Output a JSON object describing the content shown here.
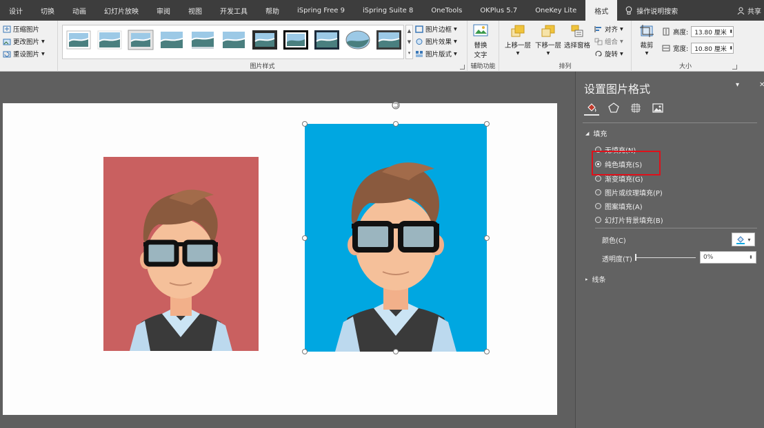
{
  "tabs": [
    "设计",
    "切换",
    "动画",
    "幻灯片放映",
    "审阅",
    "视图",
    "开发工具",
    "帮助",
    "iSpring Free 9",
    "iSpring Suite 8",
    "OneTools",
    "OKPlus 5.7",
    "OneKey Lite",
    "格式"
  ],
  "tell_me": "操作说明搜索",
  "share": "共享",
  "adjust": {
    "compress": "压缩图片",
    "change": "更改图片",
    "reset": "重设图片"
  },
  "picture_styles": {
    "group_label": "图片样式",
    "border": "图片边框",
    "effects": "图片效果",
    "layout": "图片版式"
  },
  "accessibility": {
    "alt_text": "替换文字",
    "group_label": "辅助功能"
  },
  "arrange": {
    "group_label": "排列",
    "forward": "上移一层",
    "backward": "下移一层",
    "selection_pane": "选择窗格",
    "align": "对齐",
    "group": "组合",
    "rotate": "旋转"
  },
  "size": {
    "group_label": "大小",
    "crop": "裁剪",
    "height_label": "高度:",
    "height_value": "13.80 厘米",
    "width_label": "宽度:",
    "width_value": "10.80 厘米"
  },
  "pane": {
    "title": "设置图片格式",
    "fill_section": "填充",
    "options": [
      "无填充(N)",
      "纯色填充(S)",
      "渐变填充(G)",
      "图片或纹理填充(P)",
      "图案填充(A)",
      "幻灯片背景填充(B)"
    ],
    "selected_option": "纯色填充(S)",
    "color_label": "颜色(C)",
    "transparency_label": "透明度(T)",
    "transparency_value": "0%",
    "line_section": "线条",
    "colors": {
      "fill_tab_icon": "#c0392b",
      "highlight": "#e0101a"
    }
  },
  "images": {
    "left_bg": "#c96060",
    "right_bg": "#00a7e1"
  }
}
